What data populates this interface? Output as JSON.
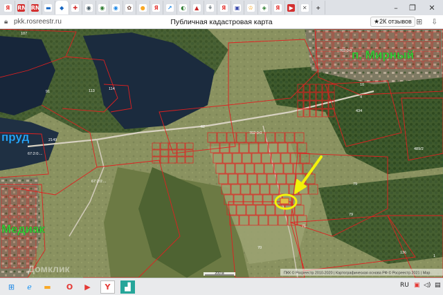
{
  "browser": {
    "tabs": [
      {
        "glyph": "Я",
        "color": "#e53935",
        "bg": "#ffffff",
        "icon": "yandex-icon"
      },
      {
        "glyph": "RN",
        "color": "#ffffff",
        "bg": "#d32f2f",
        "icon": "rn-icon"
      },
      {
        "glyph": "RN",
        "color": "#ffffff",
        "bg": "#d32f2f",
        "icon": "rn-icon"
      },
      {
        "glyph": "▬",
        "color": "#1565c0",
        "bg": "#ffffff",
        "icon": "flag-icon"
      },
      {
        "glyph": "◆",
        "color": "#1565c0",
        "bg": "#ffffff",
        "icon": "rosreestr-icon",
        "active": true
      },
      {
        "glyph": "✚",
        "color": "#d32f2f",
        "bg": "#ffffff",
        "icon": "star-icon"
      },
      {
        "glyph": "◉",
        "color": "#455a64",
        "bg": "#ffffff",
        "icon": "globe-icon"
      },
      {
        "glyph": "◉",
        "color": "#2e7d32",
        "bg": "#ffffff",
        "icon": "globe-icon"
      },
      {
        "glyph": "◉",
        "color": "#1e88e5",
        "bg": "#ffffff",
        "icon": "globe-icon"
      },
      {
        "glyph": "✿",
        "color": "#6d4c41",
        "bg": "#ffffff",
        "icon": "flower-icon"
      },
      {
        "glyph": "●",
        "color": "#f9a825",
        "bg": "#ffffff",
        "icon": "coin-icon"
      },
      {
        "glyph": "Я",
        "color": "#e53935",
        "bg": "#ffffff",
        "icon": "yandex-icon"
      },
      {
        "glyph": "↗",
        "color": "#1e88e5",
        "bg": "#ffffff",
        "icon": "arrow-icon"
      },
      {
        "glyph": "◐",
        "color": "#2e7d32",
        "bg": "#ffffff",
        "icon": "site-icon"
      },
      {
        "glyph": "▲",
        "color": "#c62828",
        "bg": "#ffffff",
        "icon": "site-icon"
      },
      {
        "glyph": "⚘",
        "color": "#37474f",
        "bg": "#ffffff",
        "icon": "site-icon"
      },
      {
        "glyph": "Я",
        "color": "#e53935",
        "bg": "#ffffff",
        "icon": "yandex-icon"
      },
      {
        "glyph": "▣",
        "color": "#3949ab",
        "bg": "#ffffff",
        "icon": "site-icon"
      },
      {
        "glyph": "♔",
        "color": "#f9a825",
        "bg": "#ffffff",
        "icon": "site-icon"
      },
      {
        "glyph": "◈",
        "color": "#2e7d32",
        "bg": "#ffffff",
        "icon": "site-icon"
      },
      {
        "glyph": "Я",
        "color": "#e53935",
        "bg": "#ffffff",
        "icon": "yandex-icon"
      },
      {
        "glyph": "▶",
        "color": "#ffffff",
        "bg": "#d32f2f",
        "icon": "video-icon"
      },
      {
        "glyph": "✕",
        "color": "#555555",
        "bg": "#ffffff",
        "icon": "close-icon"
      },
      {
        "glyph": "+",
        "color": "#333333",
        "bg": "#dee1e6",
        "icon": "new-tab-icon"
      }
    ],
    "url": "pkk.rosreestr.ru",
    "page_title": "Публичная кадастровая карта",
    "reviews": "★2К отзывов"
  },
  "map": {
    "places": {
      "mirny": "п. Мирный",
      "prud": "пруд",
      "mediak": "Медиак"
    },
    "parcel_labels": [
      {
        "id": "p107",
        "text": "107"
      },
      {
        "id": "p91",
        "text": "91"
      },
      {
        "id": "p113",
        "text": "113"
      },
      {
        "id": "p114",
        "text": "114"
      },
      {
        "id": "p2149",
        "text": "2149"
      },
      {
        "id": "q1",
        "text": "67:2:0:..."
      },
      {
        "id": "q2",
        "text": "67:2:0:..."
      },
      {
        "id": "p62",
        "text": "62"
      },
      {
        "id": "p10",
        "text": "10"
      },
      {
        "id": "q3",
        "text": "702:0:0"
      },
      {
        "id": "q4",
        "text": "702:0:0"
      },
      {
        "id": "p4",
        "text": "4"
      },
      {
        "id": "p434",
        "text": "434"
      },
      {
        "id": "p4892",
        "text": "489/2"
      },
      {
        "id": "p79a",
        "text": "79"
      },
      {
        "id": "p79b",
        "text": "79"
      },
      {
        "id": "p71",
        "text": "71"
      },
      {
        "id": "p70",
        "text": "70"
      },
      {
        "id": "p136",
        "text": "136"
      },
      {
        "id": "p1",
        "text": "1"
      }
    ],
    "scale": "200 м",
    "copyright": "ПКК © Росреестр 2010-2020 | Картографическая основа РФ © Росреестр 2021 | Map",
    "watermark": "Домклик"
  },
  "taskbar": {
    "language": "RU"
  }
}
